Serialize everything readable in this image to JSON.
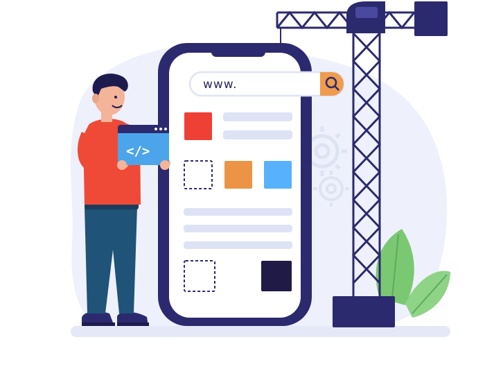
{
  "illustration": {
    "search_bar": {
      "text": "www."
    },
    "code_window": {
      "text": "</>"
    },
    "colors": {
      "navy": "#2c2a6e",
      "phone_screen": "#ffffff",
      "blob_bg": "#eef1fb",
      "ground": "#e4e8f7",
      "line_placeholder": "#dde3f5",
      "red_block": "#ef4036",
      "orange_block": "#ec9446",
      "blue_block": "#58b2fb",
      "dark_block": "#201a47",
      "search_orange": "#ef9c4e",
      "shirt": "#ef4a37",
      "pants": "#1f5378",
      "window_blue": "#4ca4ea",
      "leaf_green": "#7bc873",
      "gear": "#dde3f2"
    }
  }
}
